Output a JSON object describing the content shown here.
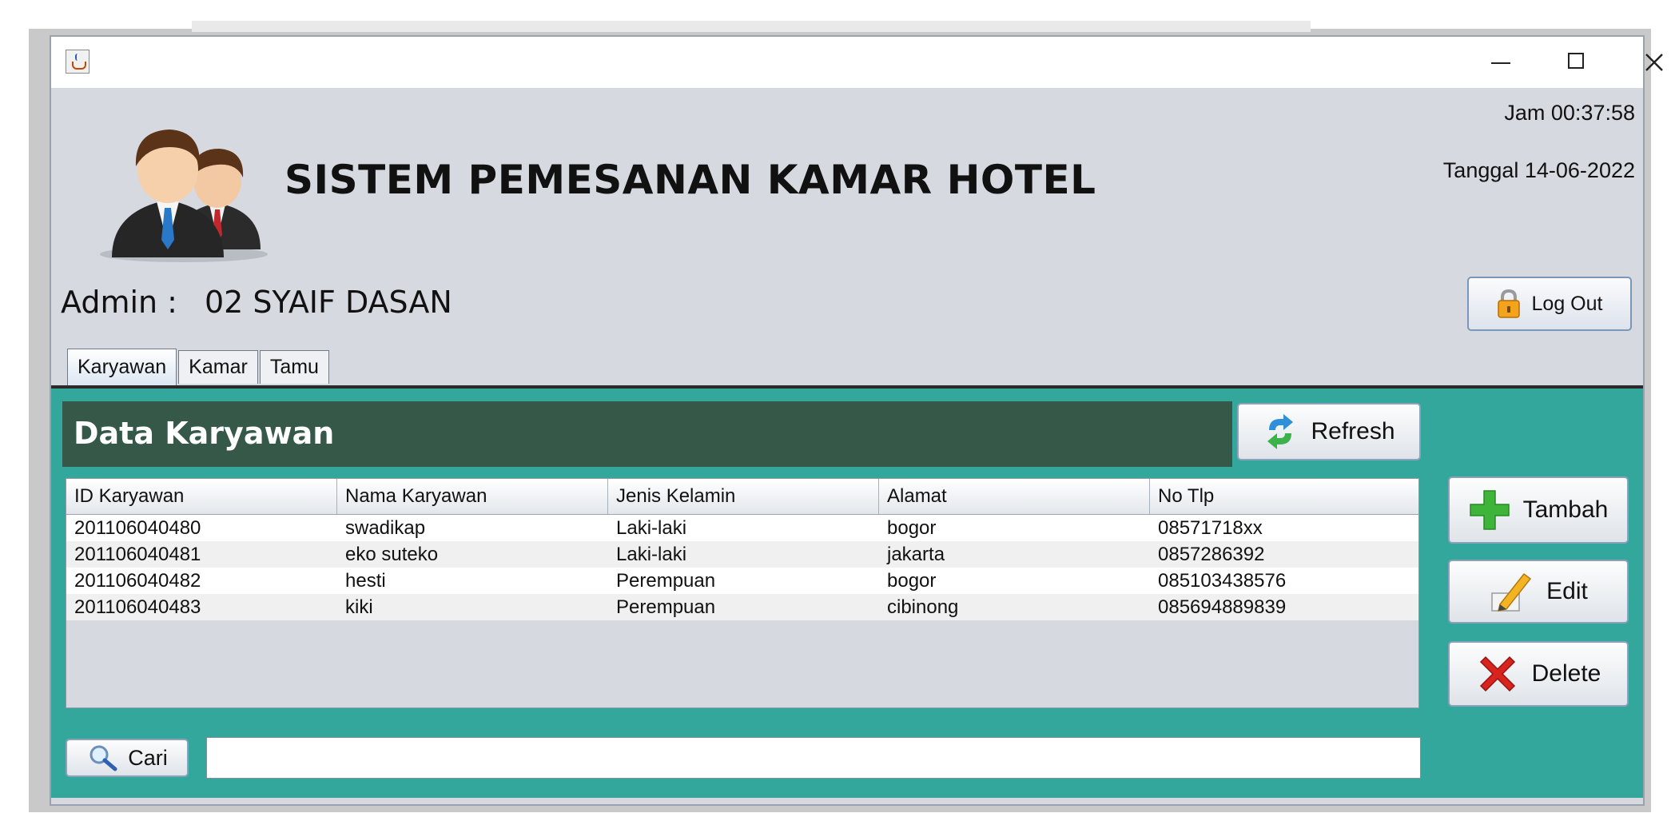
{
  "header": {
    "title": "SISTEM PEMESANAN KAMAR HOTEL",
    "clock": "Jam 00:37:58",
    "date": "Tanggal 14-06-2022",
    "admin_label": "Admin :",
    "admin_value": "02 SYAIF DASAN",
    "logout_label": "Log Out"
  },
  "tabs": [
    {
      "label": "Karyawan",
      "active": true
    },
    {
      "label": "Kamar",
      "active": false
    },
    {
      "label": "Tamu",
      "active": false
    }
  ],
  "panel": {
    "heading": "Data Karyawan",
    "refresh_label": "Refresh",
    "tambah_label": "Tambah",
    "edit_label": "Edit",
    "delete_label": "Delete",
    "cari_label": "Cari",
    "search_value": ""
  },
  "table": {
    "columns": [
      "ID Karyawan",
      "Nama Karyawan",
      "Jenis Kelamin",
      "Alamat",
      "No Tlp"
    ],
    "rows": [
      [
        "201106040480",
        "swadikap",
        "Laki-laki",
        "bogor",
        "08571718xx"
      ],
      [
        "201106040481",
        "eko suteko",
        "Laki-laki",
        "jakarta",
        "0857286392"
      ],
      [
        "201106040482",
        "hesti",
        "Perempuan",
        "bogor",
        "085103438576"
      ],
      [
        "201106040483",
        "kiki",
        "Perempuan",
        "cibinong",
        "085694889839"
      ]
    ]
  },
  "colors": {
    "panel_teal": "#33a79c",
    "header_dark_green": "#355849",
    "window_bg": "#d6d9e0"
  }
}
